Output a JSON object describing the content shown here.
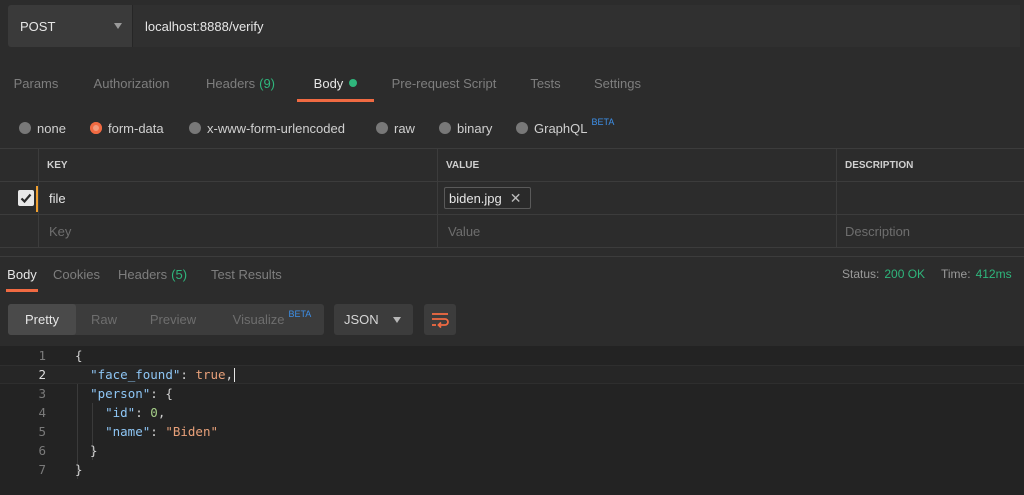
{
  "request": {
    "method": "POST",
    "url": "localhost:8888/verify"
  },
  "request_tabs": {
    "params": "Params",
    "authorization": "Authorization",
    "headers": "Headers",
    "headers_count": "(9)",
    "body": "Body",
    "prerequest": "Pre-request Script",
    "tests": "Tests",
    "settings": "Settings"
  },
  "body_types": {
    "none": "none",
    "form_data": "form-data",
    "urlencoded": "x-www-form-urlencoded",
    "raw": "raw",
    "binary": "binary",
    "graphql": "GraphQL",
    "beta": "BETA",
    "selected": "form-data"
  },
  "params_table": {
    "headers": {
      "key": "KEY",
      "value": "VALUE",
      "description": "DESCRIPTION"
    },
    "rows": [
      {
        "checked": true,
        "key": "file",
        "value": "biden.jpg",
        "description": ""
      }
    ],
    "placeholders": {
      "key": "Key",
      "value": "Value",
      "description": "Description"
    }
  },
  "response_tabs": {
    "body": "Body",
    "cookies": "Cookies",
    "headers": "Headers",
    "headers_count": "(5)",
    "test_results": "Test Results"
  },
  "response_status": {
    "status_label": "Status:",
    "status_value": "200 OK",
    "time_label": "Time:",
    "time_value": "412ms"
  },
  "view": {
    "pretty": "Pretty",
    "raw": "Raw",
    "preview": "Preview",
    "visualize": "Visualize",
    "beta": "BETA",
    "language": "JSON"
  },
  "code": {
    "line_numbers": [
      "1",
      "2",
      "3",
      "4",
      "5",
      "6",
      "7"
    ],
    "key_face_found": "\"face_found\"",
    "val_true": "true",
    "key_person": "\"person\"",
    "key_id": "\"id\"",
    "val_id": "0",
    "key_name": "\"name\"",
    "val_name": "\"Biden\""
  },
  "colors": {
    "accent": "#f06a42",
    "success": "#2fb67c",
    "beta": "#3d8fe8"
  }
}
